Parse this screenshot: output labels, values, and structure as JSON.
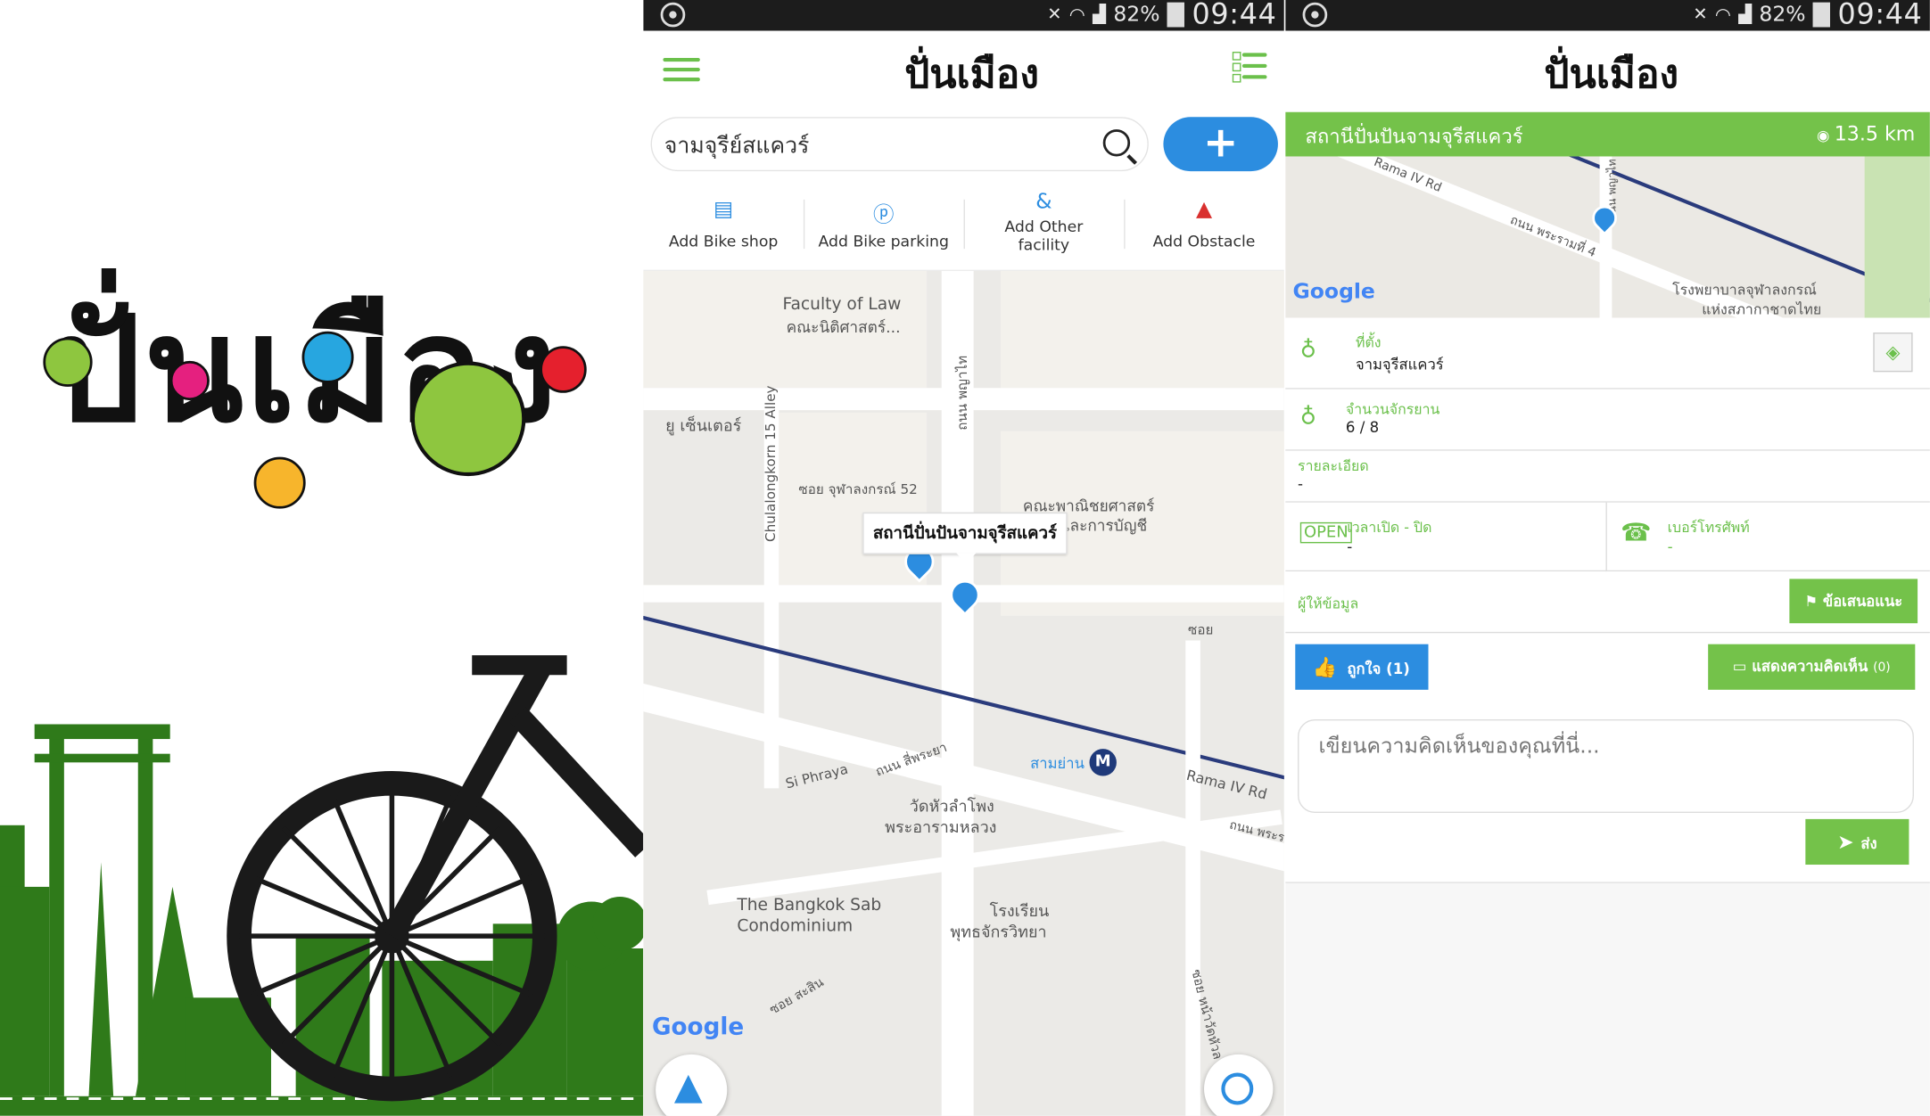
{
  "status_bar": {
    "battery": "82%",
    "time": "09:44"
  },
  "app_logo": "ปั่นเมือง",
  "panel2": {
    "search_value": "จามจุรีย์สแควร์",
    "add_label": "+",
    "actions": [
      {
        "label": "Add Bike shop",
        "icon": "shop-icon"
      },
      {
        "label": "Add Bike parking",
        "icon": "parking-icon"
      },
      {
        "label": "Add Other facility",
        "icon": "ampersand-icon"
      },
      {
        "label": "Add Obstacle",
        "icon": "warning-icon"
      }
    ],
    "map": {
      "callout": "สถานีปั่นปันจามจุรีสแควร์",
      "labels": {
        "faculty_law": "Faculty of Law",
        "faculty_law_th": "คณะนิติศาสตร์...",
        "u_center": "ยู เซ็นเตอร์",
        "chula_alley": "Chulalongkorn 15 Alley",
        "soi_chula52": "ซอย จุฬาลงกรณ์ 52",
        "thanon_phayathai": "ถนน พญาไท",
        "commerce": "คณะพาณิชยศาสตร์",
        "accounting": "และการบัญชี",
        "soi": "ซอย",
        "samyan": "สามย่าน",
        "rama4": "Rama IV Rd",
        "thanon_phra": "ถนน พระร",
        "si_phraya": "Si Phraya",
        "thanon_siphraya": "ถนน สี่พระยา",
        "wat": "วัดหัวลำโพง",
        "wat2": "พระอารามหลวง",
        "bangkok_sab": "The Bangkok Sab",
        "condominium": "Condominium",
        "school": "โรงเรียน",
        "school2": "พุทธจักรวิทยา",
        "soi_sasin": "ซอย สะสิน",
        "soi_mahawiset": "ซอย หน้าวัดหัวล",
        "google": "Google"
      }
    }
  },
  "panel3": {
    "station_title": "สถานีปั่นปันจามจุรีสแควร์",
    "distance": "13.5 km",
    "map_labels": {
      "rama4": "Rama IV Rd",
      "thanon_phra": "ถนน พระรามที่ 4",
      "hospital": "โรงพยาบาลจุฬาลงกรณ์",
      "hospital2": "แห่งสภากาชาดไทย",
      "phayathai": "ถนน พญาไท",
      "google": "Google"
    },
    "location_label": "ที่ตั้ง",
    "location_value": "จามจุรีสแควร์",
    "bikes_label": "จำนวนจักรยาน",
    "bikes_value": "6 / 8",
    "detail_label": "รายละเอียด",
    "detail_value": "-",
    "hours_label": "เวลาเปิด - ปิด",
    "hours_value": "-",
    "phone_label": "เบอร์โทรศัพท์",
    "phone_value": "-",
    "provider_label": "ผู้ให้ข้อมูล",
    "suggest_button": "ข้อเสนอแนะ",
    "like_button": "ถูกใจ (1)",
    "comments_button": "แสดงความคิดเห็น",
    "comments_count": "(0)",
    "comment_placeholder": "เขียนความคิดเห็นของคุณที่นี่...",
    "send_button": "ส่ง"
  },
  "colors": {
    "green": "#74c24a",
    "blue": "#2c8de0",
    "dark_green": "#2f7a1a"
  }
}
